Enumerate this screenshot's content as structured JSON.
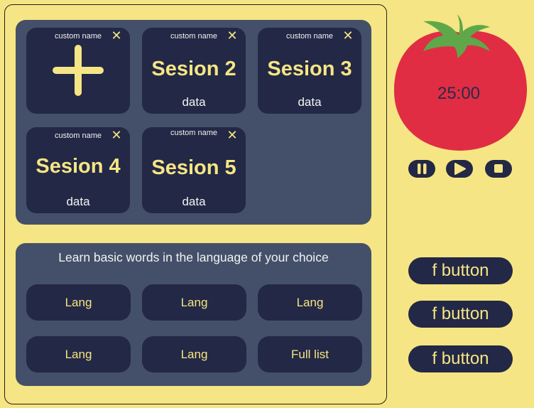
{
  "sessions": {
    "add_card": {
      "custom_name": "custom name",
      "close_glyph": "✕",
      "icon": "plus-icon"
    },
    "cards": [
      {
        "custom_name": "custom name",
        "title": "Sesion 2",
        "data": "data",
        "close_glyph": "✕"
      },
      {
        "custom_name": "custom name",
        "title": "Sesion 3",
        "data": "data",
        "close_glyph": "✕"
      },
      {
        "custom_name": "custom name",
        "title": "Sesion 4",
        "data": "data",
        "close_glyph": "✕"
      },
      {
        "custom_name": "custom name",
        "title": "Sesion 5",
        "data": "data",
        "close_glyph": "✕"
      }
    ]
  },
  "languages": {
    "title": "Learn basic words in the language of your choice",
    "buttons": [
      "Lang",
      "Lang",
      "Lang",
      "Lang",
      "Lang",
      "Full list"
    ]
  },
  "timer": {
    "display": "25:00",
    "controls": [
      "pause-icon",
      "play-icon",
      "stop-icon"
    ]
  },
  "side_buttons": [
    "f button",
    "f button",
    "f button"
  ],
  "colors": {
    "background": "#F6E584",
    "panel": "#445069",
    "card": "#222845",
    "accent": "#F6E584",
    "tomato": "#E02D44",
    "tomato_leaf": "#5FA84A"
  }
}
